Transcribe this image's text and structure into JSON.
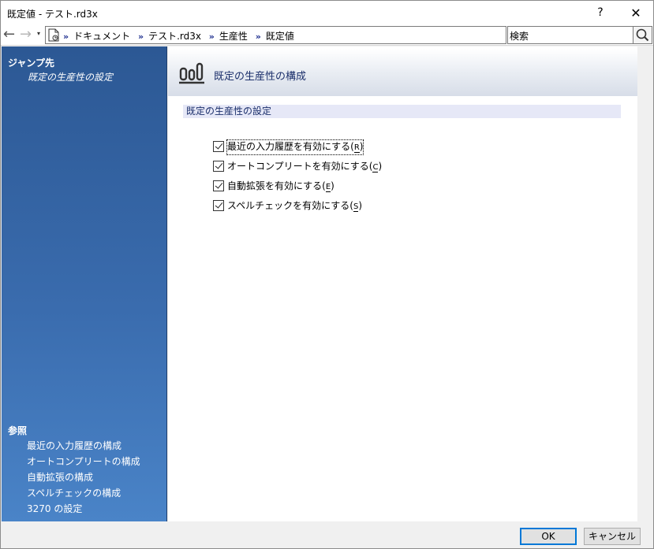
{
  "window": {
    "title": "既定値 - テスト.rd3x",
    "help_label": "?",
    "close_label": "✕"
  },
  "nav": {
    "back_icon": "←",
    "forward_icon": "→",
    "dropdown_icon": "▾",
    "breadcrumbs": [
      "ドキュメント",
      "テスト.rd3x",
      "生産性",
      "既定値"
    ],
    "separator": "»",
    "search_placeholder": "検索"
  },
  "sidebar": {
    "jump_title": "ジャンプ先",
    "jump_link": "既定の生産性の設定",
    "reference_title": "参照",
    "reference_links": [
      "最近の入力履歴の構成",
      "オートコンプリートの構成",
      "自動拡張の構成",
      "スペルチェックの構成",
      "3270 の設定"
    ]
  },
  "content": {
    "header_title": "既定の生産性の構成",
    "section_title": "既定の生産性の設定",
    "options": [
      {
        "label": "最近の入力履歴を有効にする",
        "accel": "R",
        "checked": true
      },
      {
        "label": "オートコンプリートを有効にする",
        "accel": "C",
        "checked": true
      },
      {
        "label": "自動拡張を有効にする",
        "accel": "E",
        "checked": true
      },
      {
        "label": "スペルチェックを有効にする",
        "accel": "S",
        "checked": true
      }
    ]
  },
  "footer": {
    "ok_label": "OK",
    "cancel_label": "キャンセル"
  }
}
